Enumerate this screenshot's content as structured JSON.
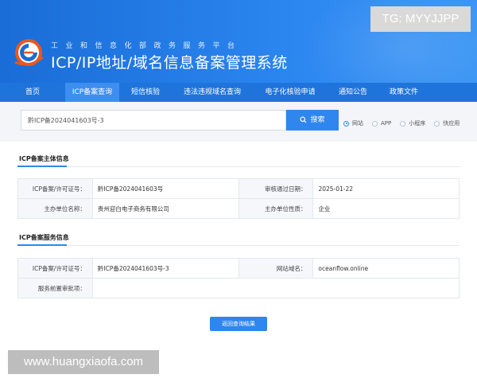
{
  "header": {
    "subtitle": "工业和信息化部政务服务平台",
    "title": "ICP/IP地址/域名信息备案管理系统"
  },
  "watermarks": {
    "top": "TG: MYYJJPP",
    "bottom": "www.huangxiaofa.com"
  },
  "nav": {
    "items": [
      {
        "label": "首页"
      },
      {
        "label": "ICP备案查询"
      },
      {
        "label": "短信核验"
      },
      {
        "label": "违法违规域名查询"
      },
      {
        "label": "电子化核验申请"
      },
      {
        "label": "通知公告"
      },
      {
        "label": "政策文件"
      }
    ],
    "active_index": 1
  },
  "search": {
    "value": "黔ICP备2024041603号-3",
    "button_label": "搜索",
    "options": [
      {
        "label": "网站",
        "checked": true
      },
      {
        "label": "APP",
        "checked": false
      },
      {
        "label": "小程序",
        "checked": false
      },
      {
        "label": "快应用",
        "checked": false
      }
    ]
  },
  "subject": {
    "title": "ICP备案主体信息",
    "row1": {
      "label_a": "ICP备案/许可证号：",
      "value_a": "黔ICP备2024041603号",
      "label_b": "审核通过日期：",
      "value_b": "2025-01-22"
    },
    "row2": {
      "label_a": "主办单位名称：",
      "value_a": "贵州迎白电子商务有限公司",
      "label_b": "主办单位性质：",
      "value_b": "企业"
    }
  },
  "service": {
    "title": "ICP备案服务信息",
    "row1": {
      "label_a": "ICP备案/许可证号：",
      "value_a": "黔ICP备2024041603号-3",
      "label_b": "网站域名：",
      "value_b": "oceanflow.online"
    },
    "row2": {
      "label_a": "服务前置审批项：",
      "value_a": ""
    }
  },
  "return_button": "返回查询结果"
}
